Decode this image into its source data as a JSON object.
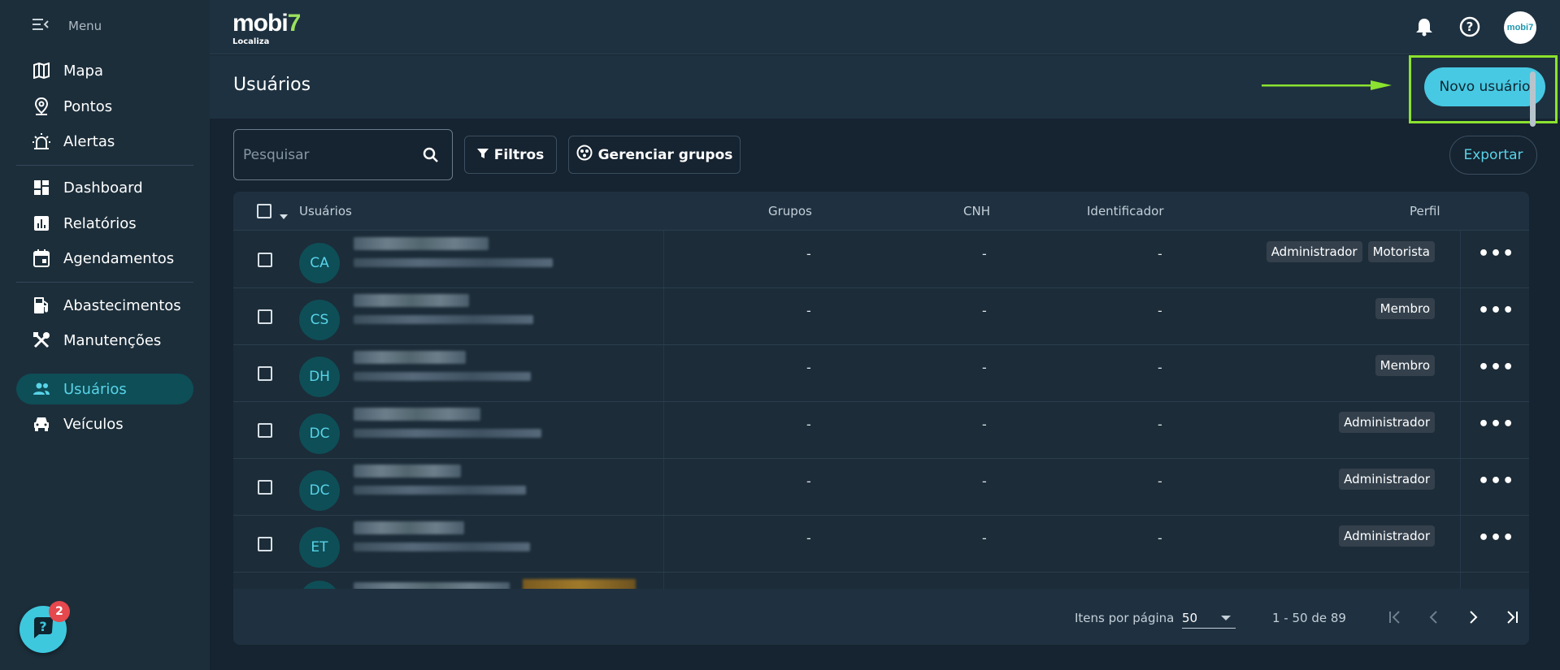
{
  "sidebar": {
    "menu_label": "Menu",
    "items": [
      {
        "label": "Mapa",
        "icon": "map-icon"
      },
      {
        "label": "Pontos",
        "icon": "location-pin-icon"
      },
      {
        "label": "Alertas",
        "icon": "alarm-light-icon"
      },
      {
        "label": "Dashboard",
        "icon": "dashboard-icon"
      },
      {
        "label": "Relatórios",
        "icon": "report-chart-icon"
      },
      {
        "label": "Agendamentos",
        "icon": "calendar-icon"
      },
      {
        "label": "Abastecimentos",
        "icon": "fuel-pump-icon"
      },
      {
        "label": "Manutenções",
        "icon": "tools-icon"
      },
      {
        "label": "Usuários",
        "icon": "users-icon",
        "active": true
      },
      {
        "label": "Veículos",
        "icon": "car-icon"
      }
    ],
    "help_badge": "2"
  },
  "topbar": {
    "logo_text": "mobi",
    "logo_seven": "7",
    "logo_sub": "Localiza",
    "avatar_text": "mobi7"
  },
  "page": {
    "title": "Usuários",
    "new_button": "Novo usuário"
  },
  "toolbar": {
    "search_placeholder": "Pesquisar",
    "filters_label": "Filtros",
    "groups_label": "Gerenciar grupos",
    "export_label": "Exportar"
  },
  "table": {
    "headers": {
      "users": "Usuários",
      "groups": "Grupos",
      "cnh": "CNH",
      "identifier": "Identificador",
      "profile": "Perfil"
    },
    "rows": [
      {
        "initials": "CA",
        "groups": "-",
        "cnh": "-",
        "identifier": "-",
        "profiles": [
          "Administrador",
          "Motorista"
        ]
      },
      {
        "initials": "CS",
        "groups": "-",
        "cnh": "-",
        "identifier": "-",
        "profiles": [
          "Membro"
        ]
      },
      {
        "initials": "DH",
        "groups": "-",
        "cnh": "-",
        "identifier": "-",
        "profiles": [
          "Membro"
        ]
      },
      {
        "initials": "DC",
        "groups": "-",
        "cnh": "-",
        "identifier": "-",
        "profiles": [
          "Administrador"
        ]
      },
      {
        "initials": "DC",
        "groups": "-",
        "cnh": "-",
        "identifier": "-",
        "profiles": [
          "Administrador"
        ]
      },
      {
        "initials": "ET",
        "groups": "-",
        "cnh": "-",
        "identifier": "-",
        "profiles": [
          "Administrador"
        ]
      }
    ],
    "footer": {
      "per_page_label": "Itens por página",
      "per_page_value": "50",
      "range": "1 - 50 de 89"
    }
  },
  "colors": {
    "accent": "#47c9e3",
    "highlight": "#8be22f",
    "active_nav_bg": "#0e4e57"
  }
}
